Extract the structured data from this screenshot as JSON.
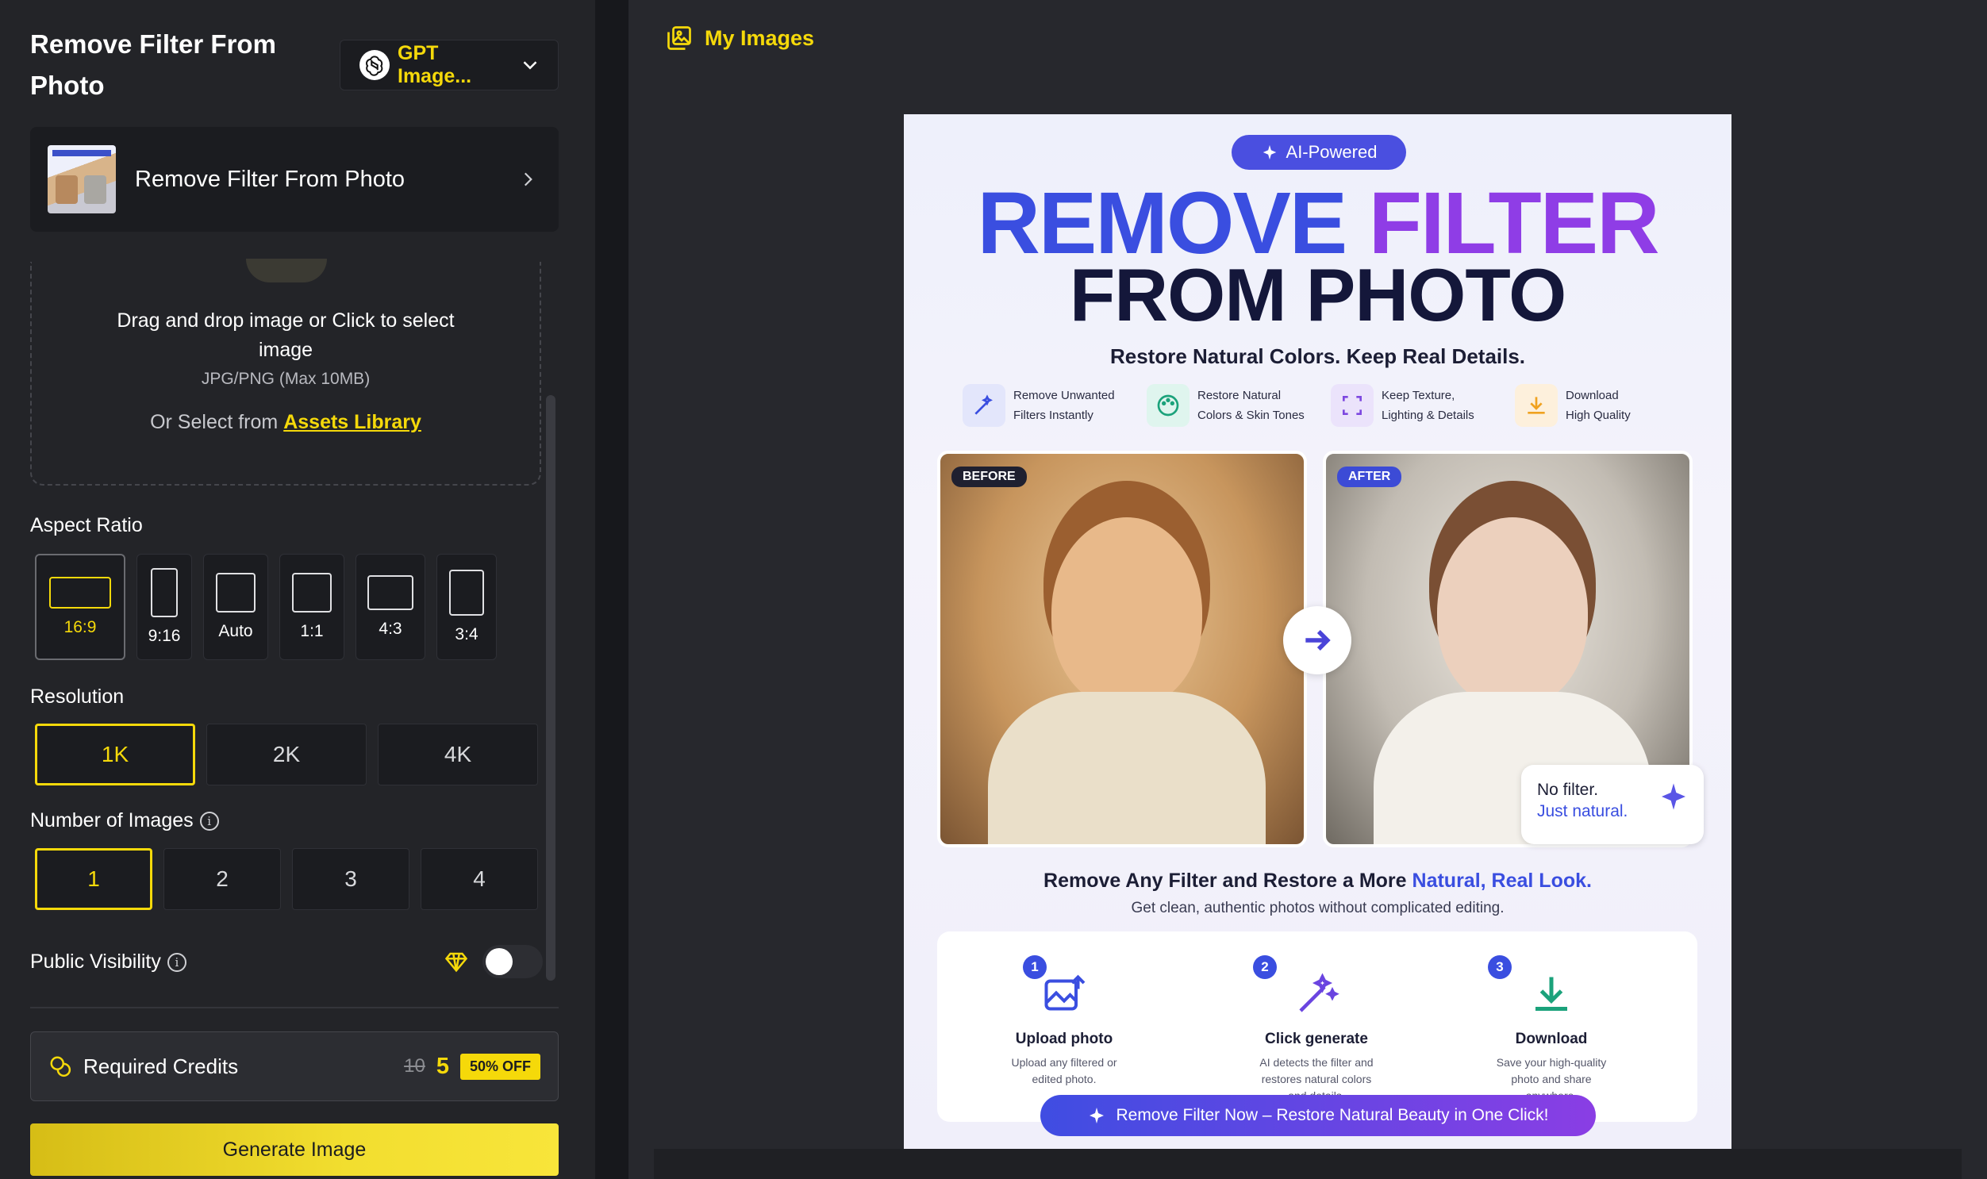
{
  "panel": {
    "title": "Remove Filter From Photo",
    "model_label": "GPT Image...",
    "tool_name": "Remove Filter From Photo"
  },
  "upload": {
    "instruction": "Drag and drop image or Click to select image",
    "formats": "JPG/PNG (Max 10MB)",
    "library_prefix": "Or Select from",
    "library_link": "Assets Library"
  },
  "aspect_ratio": {
    "label": "Aspect Ratio",
    "options": [
      "16:9",
      "9:16",
      "Auto",
      "1:1",
      "4:3",
      "3:4"
    ],
    "selected": "16:9"
  },
  "resolution": {
    "label": "Resolution",
    "options": [
      "1K",
      "2K",
      "4K"
    ],
    "selected": "1K"
  },
  "num_images": {
    "label": "Number of Images",
    "options": [
      "1",
      "2",
      "3",
      "4"
    ],
    "selected": "1"
  },
  "visibility": {
    "label": "Public Visibility",
    "enabled": false
  },
  "credits": {
    "label": "Required Credits",
    "old": "10",
    "new": "5",
    "discount": "50% OFF"
  },
  "generate_label": "Generate Image",
  "gallery": {
    "header": "My Images"
  },
  "poster": {
    "pill": "AI-Powered",
    "headline_1a": "REMOVE",
    "headline_1b": "FILTER",
    "headline_2": "FROM PHOTO",
    "subtitle": "Restore Natural Colors. Keep Real Details.",
    "features": [
      {
        "line1": "Remove Unwanted",
        "line2": "Filters Instantly"
      },
      {
        "line1": "Restore Natural",
        "line2": "Colors & Skin Tones"
      },
      {
        "line1": "Keep Texture,",
        "line2": "Lighting & Details"
      },
      {
        "line1": "Download",
        "line2": "High Quality"
      }
    ],
    "before_tag": "BEFORE",
    "after_tag": "AFTER",
    "badge_line1": "No filter.",
    "badge_line2": "Just natural.",
    "tagline_prefix": "Remove Any Filter and Restore a More",
    "tagline_blue": "Natural, Real Look.",
    "tagline_sub": "Get clean, authentic photos without complicated editing.",
    "steps": [
      {
        "num": "1",
        "title": "Upload photo",
        "desc": "Upload any filtered or edited photo."
      },
      {
        "num": "2",
        "title": "Click generate",
        "desc": "AI detects the filter and restores natural colors and details."
      },
      {
        "num": "3",
        "title": "Download",
        "desc": "Save your high-quality photo and share anywhere."
      }
    ],
    "cta": "Remove Filter Now – Restore Natural Beauty in One Click!"
  },
  "colors": {
    "accent": "#f5d90a",
    "panel_bg": "#232428",
    "poster_blue": "#3a4ee0",
    "poster_purple": "#8f3de6"
  }
}
